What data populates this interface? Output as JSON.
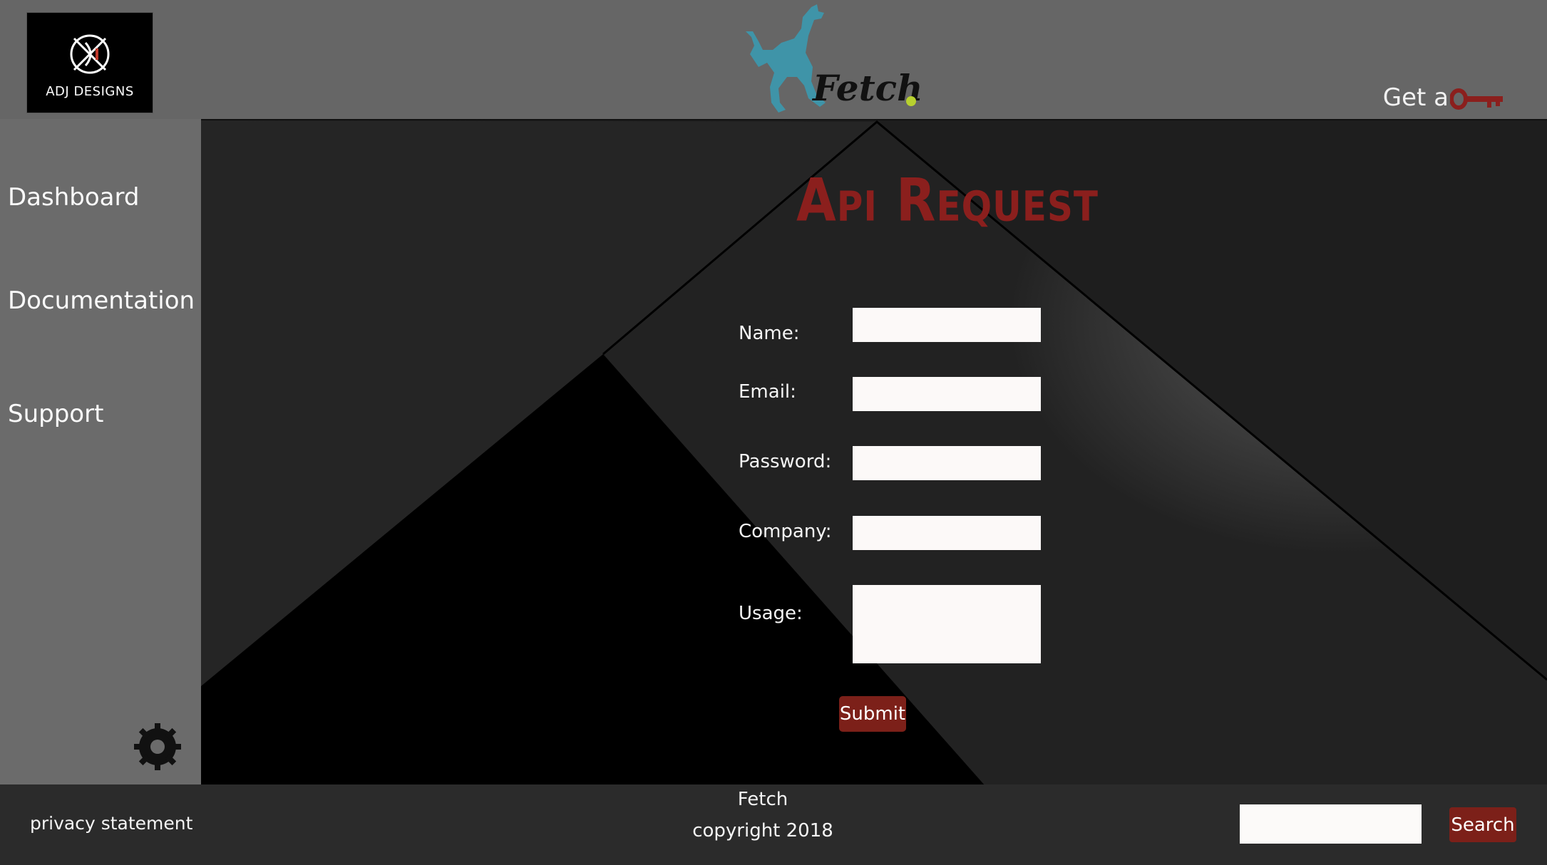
{
  "brand": {
    "name": "ADJ DESIGNS"
  },
  "header": {
    "logo_text": "Fetch",
    "key_link_text": "Get a",
    "key_icon": "key-icon",
    "accent": "#8b1f1d",
    "logo_color": "#3f94a8"
  },
  "sidebar": {
    "items": [
      {
        "label": "Dashboard"
      },
      {
        "label": "Documentation"
      },
      {
        "label": "Support"
      }
    ],
    "settings_icon": "gear-icon"
  },
  "form": {
    "title": "Api Request",
    "fields": [
      {
        "label": "Name:",
        "value": ""
      },
      {
        "label": "Email:",
        "value": ""
      },
      {
        "label": "Password:",
        "value": ""
      },
      {
        "label": "Company:",
        "value": ""
      },
      {
        "label": "Usage:",
        "value": ""
      }
    ],
    "submit_label": "Submit"
  },
  "footer": {
    "privacy_label": "privacy statement",
    "app_name": "Fetch",
    "copyright": "copyright 2018",
    "search_value": "",
    "search_label": "Search"
  }
}
